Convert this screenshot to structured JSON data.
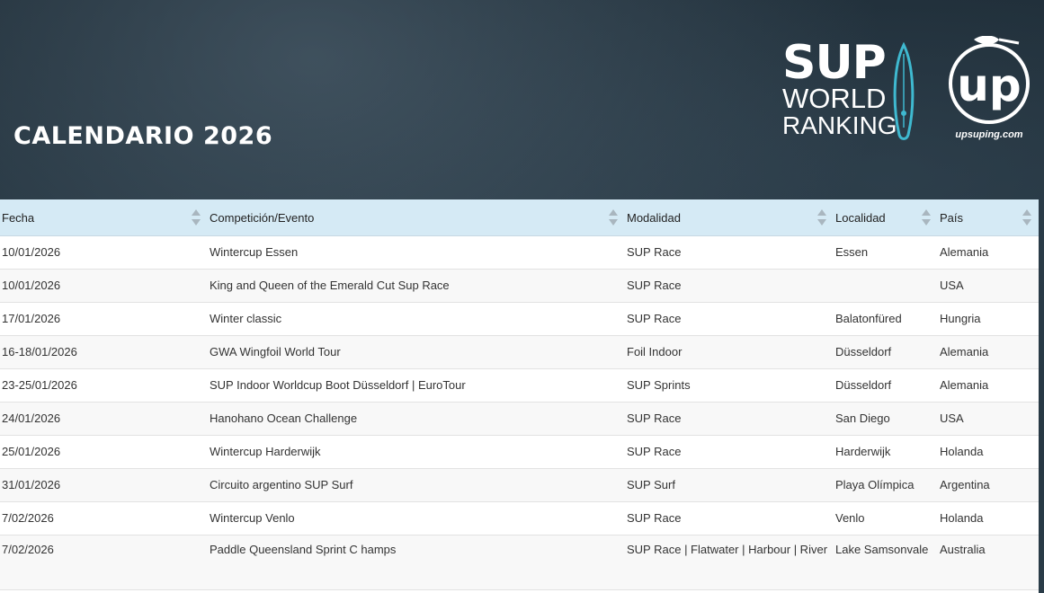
{
  "header": {
    "title": "CALENDARIO 2026",
    "sup_logo": {
      "line1": "SUP",
      "line2": "WORLD",
      "line3": "RANKING",
      "icon": "paddleboard-icon"
    },
    "up_logo": {
      "text": "up",
      "url": "upsuping.com"
    }
  },
  "table": {
    "columns": [
      "Fecha",
      "Competición/Evento",
      "Modalidad",
      "Localidad",
      "País"
    ],
    "rows": [
      [
        "10/01/2026",
        "Wintercup Essen",
        "SUP Race",
        "Essen",
        "Alemania"
      ],
      [
        "10/01/2026",
        "King and Queen of the Emerald Cut Sup Race",
        "SUP Race",
        "",
        "USA"
      ],
      [
        "17/01/2026",
        "Winter classic",
        "SUP Race",
        "Balatonfüred",
        "Hungria"
      ],
      [
        "16-18/01/2026",
        "GWA Wingfoil World Tour",
        "Foil Indoor",
        "Düsseldorf",
        "Alemania"
      ],
      [
        "23-25/01/2026",
        "SUP Indoor Worldcup Boot Düsseldorf | EuroTour",
        "SUP Sprints",
        "Düsseldorf",
        "Alemania"
      ],
      [
        "24/01/2026",
        "Hanohano Ocean Challenge",
        "SUP Race",
        "San Diego",
        "USA"
      ],
      [
        "25/01/2026",
        "Wintercup Harderwijk",
        "SUP Race",
        "Harderwijk",
        "Holanda"
      ],
      [
        "31/01/2026",
        "Circuito argentino SUP Surf",
        "SUP Surf",
        "Playa Olímpica",
        "Argentina"
      ],
      [
        "7/02/2026",
        "Wintercup Venlo",
        "SUP Race",
        "Venlo",
        "Holanda"
      ],
      [
        "7/02/2026",
        "Paddle Queensland Sprint C hamps",
        "SUP Race | Flatwater | Harbour | River",
        "Lake Samsonvale",
        "Australia"
      ]
    ]
  }
}
